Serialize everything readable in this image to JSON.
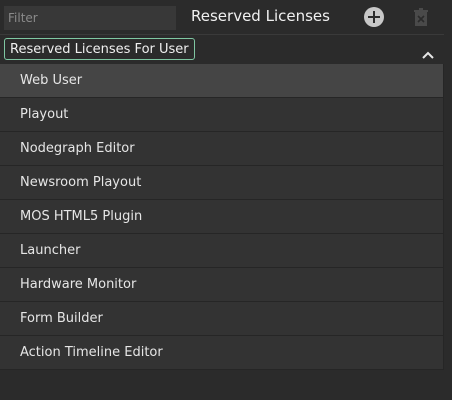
{
  "filter": {
    "placeholder": "Filter",
    "value": ""
  },
  "header": {
    "title": "Reserved Licenses",
    "add_icon": "add-circle-icon",
    "delete_icon": "trash-icon"
  },
  "section": {
    "label": "Reserved Licenses For User",
    "chevron_icon": "chevron-up-icon",
    "accent_color": "#7fc7a2"
  },
  "list": {
    "items": [
      {
        "label": "Web User",
        "selected": true
      },
      {
        "label": "Playout",
        "selected": false
      },
      {
        "label": "Nodegraph Editor",
        "selected": false
      },
      {
        "label": "Newsroom Playout",
        "selected": false
      },
      {
        "label": "MOS HTML5 Plugin",
        "selected": false
      },
      {
        "label": "Launcher",
        "selected": false
      },
      {
        "label": "Hardware Monitor",
        "selected": false
      },
      {
        "label": "Form Builder",
        "selected": false
      },
      {
        "label": "Action Timeline Editor",
        "selected": false
      }
    ]
  }
}
